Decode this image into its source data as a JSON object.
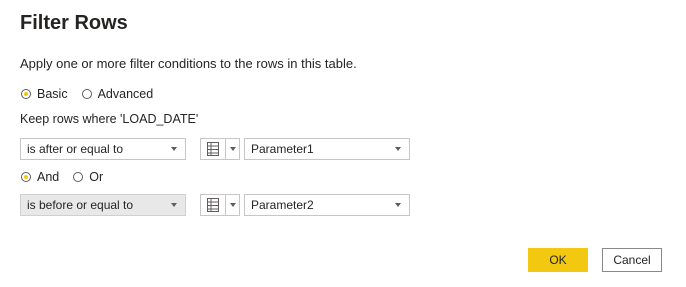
{
  "dialog": {
    "title": "Filter Rows",
    "description": "Apply one or more filter conditions to the rows in this table."
  },
  "mode": {
    "basic_label": "Basic",
    "advanced_label": "Advanced",
    "selected": "Basic"
  },
  "keep_rows_label": "Keep rows where 'LOAD_DATE'",
  "condition1": {
    "operator": "is after or equal to",
    "value_type_icon": "table-icon",
    "value": "Parameter1"
  },
  "logic": {
    "and_label": "And",
    "or_label": "Or",
    "selected": "And"
  },
  "condition2": {
    "operator": "is before or equal to",
    "value_type_icon": "table-icon",
    "value": "Parameter2"
  },
  "buttons": {
    "ok_label": "OK",
    "cancel_label": "Cancel"
  },
  "colors": {
    "accent": "#f2c811",
    "border": "#c8c6c4",
    "text": "#252423"
  }
}
